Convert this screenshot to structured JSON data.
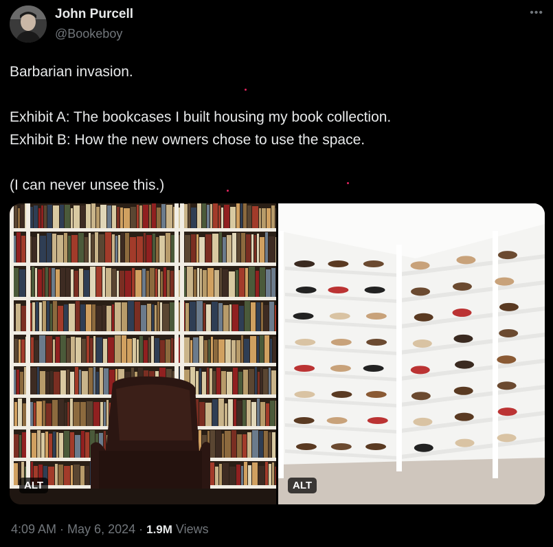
{
  "author": {
    "display_name": "John Purcell",
    "handle": "@Bookeboy",
    "avatar_icon": "user-avatar-icon"
  },
  "tweet": {
    "lines": [
      "Barbarian invasion.",
      "",
      "Exhibit A: The bookcases I built housing my book collection.",
      "Exhibit B: How the new owners chose to use the space.",
      "",
      "(I can never unsee this.)"
    ]
  },
  "media": {
    "left": {
      "alt_label": "ALT",
      "subject": "bookcases-with-leather-armchair"
    },
    "right": {
      "alt_label": "ALT",
      "subject": "shelves-with-shoes"
    }
  },
  "meta": {
    "time": "4:09 AM",
    "sep1": " · ",
    "date": "May 6, 2024",
    "sep2": " · ",
    "views_count": "1.9M",
    "views_label": " Views"
  },
  "colors": {
    "background": "#000000",
    "text": "#e7e9ea",
    "secondary": "#71767b",
    "red_dot": "#e0245e"
  },
  "icons": {
    "more": "more-options-icon"
  }
}
